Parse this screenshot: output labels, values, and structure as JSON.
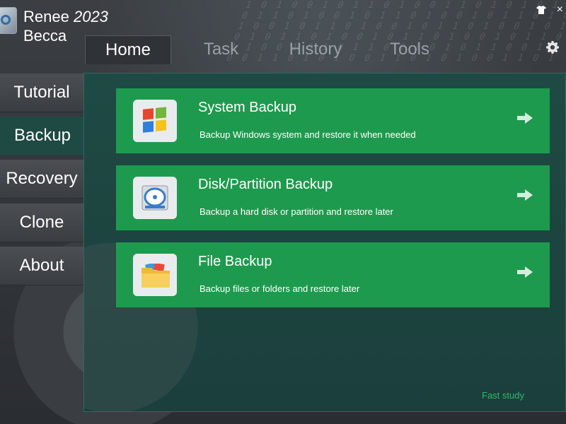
{
  "app": {
    "brand_name": "Renee",
    "brand_year": "2023",
    "brand_product": "Becca",
    "shirt_icon": "shirt-icon",
    "close_glyph": "×"
  },
  "tabs": [
    {
      "label": "Home",
      "active": true
    },
    {
      "label": "Task",
      "active": false
    },
    {
      "label": "History",
      "active": false
    },
    {
      "label": "Tools",
      "active": false
    }
  ],
  "sidebar": {
    "items": [
      {
        "label": "Tutorial",
        "active": false
      },
      {
        "label": "Backup",
        "active": true
      },
      {
        "label": "Recovery",
        "active": false
      },
      {
        "label": "Clone",
        "active": false
      },
      {
        "label": "About",
        "active": false
      }
    ]
  },
  "cards": [
    {
      "title": "System Backup",
      "description": "Backup Windows system and restore it when needed",
      "icon": "windows-logo-icon"
    },
    {
      "title": "Disk/Partition Backup",
      "description": "Backup a hard disk or partition and restore later",
      "icon": "hard-disk-icon"
    },
    {
      "title": "File Backup",
      "description": "Backup files or folders and restore later",
      "icon": "folder-icon"
    }
  ],
  "footer": {
    "fast_study": "Fast study"
  },
  "colors": {
    "card_green": "#1e9a4e",
    "panel_teal": "#1f4a44",
    "fast_study_green": "#2fb86a"
  }
}
